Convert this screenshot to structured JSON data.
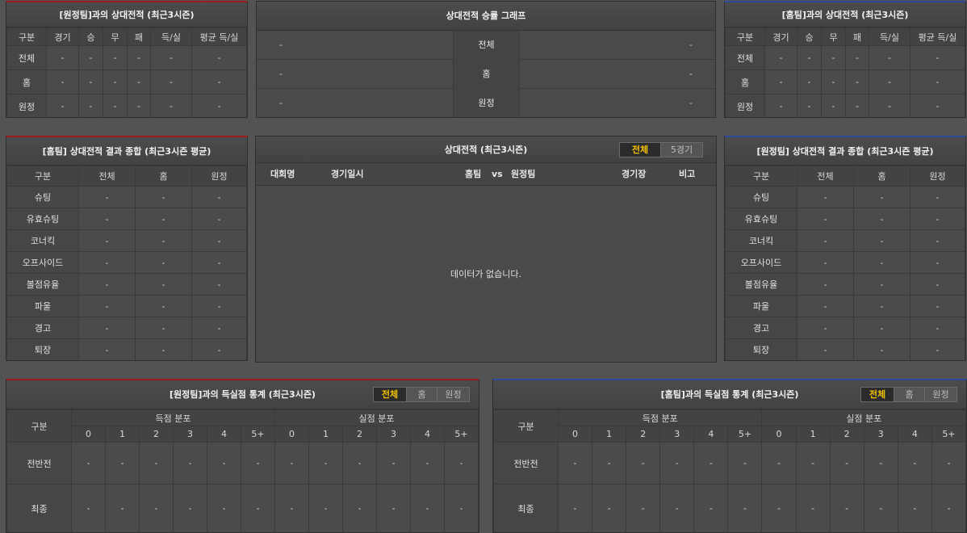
{
  "away_h2h": {
    "title": "[원정팀]과의 상대전적 (최근3시즌)",
    "headers": [
      "구분",
      "경기",
      "승",
      "무",
      "패",
      "득/실",
      "평균 득/실"
    ],
    "rows": [
      {
        "label": "전체",
        "cells": [
          "-",
          "-",
          "-",
          "-",
          "-",
          "-"
        ]
      },
      {
        "label": "홈",
        "cells": [
          "-",
          "-",
          "-",
          "-",
          "-",
          "-"
        ]
      },
      {
        "label": "원정",
        "cells": [
          "-",
          "-",
          "-",
          "-",
          "-",
          "-"
        ]
      }
    ]
  },
  "home_h2h": {
    "title": "[홈팀]과의 상대전적 (최근3시즌)",
    "headers": [
      "구분",
      "경기",
      "승",
      "무",
      "패",
      "득/실",
      "평균 득/실"
    ],
    "rows": [
      {
        "label": "전체",
        "cells": [
          "-",
          "-",
          "-",
          "-",
          "-",
          "-"
        ]
      },
      {
        "label": "홈",
        "cells": [
          "-",
          "-",
          "-",
          "-",
          "-",
          "-"
        ]
      },
      {
        "label": "원정",
        "cells": [
          "-",
          "-",
          "-",
          "-",
          "-",
          "-"
        ]
      }
    ]
  },
  "graph": {
    "title": "상대전적 승률 그래프",
    "rows": [
      {
        "label": "전체",
        "left": "-",
        "right": "-"
      },
      {
        "label": "홈",
        "left": "-",
        "right": "-"
      },
      {
        "label": "원정",
        "left": "-",
        "right": "-"
      }
    ]
  },
  "home_summary": {
    "title": "[홈팀] 상대전적 결과 종합 (최근3시즌 평균)",
    "headers": [
      "구분",
      "전체",
      "홈",
      "원정"
    ],
    "rows": [
      {
        "label": "슈팅",
        "cells": [
          "-",
          "-",
          "-"
        ]
      },
      {
        "label": "유효슈팅",
        "cells": [
          "-",
          "-",
          "-"
        ]
      },
      {
        "label": "코너킥",
        "cells": [
          "-",
          "-",
          "-"
        ]
      },
      {
        "label": "오프사이드",
        "cells": [
          "-",
          "-",
          "-"
        ]
      },
      {
        "label": "볼점유율",
        "cells": [
          "-",
          "-",
          "-"
        ]
      },
      {
        "label": "파울",
        "cells": [
          "-",
          "-",
          "-"
        ]
      },
      {
        "label": "경고",
        "cells": [
          "-",
          "-",
          "-"
        ]
      },
      {
        "label": "퇴장",
        "cells": [
          "-",
          "-",
          "-"
        ]
      }
    ]
  },
  "away_summary": {
    "title": "[원정팀] 상대전적 결과 종합 (최근3시즌 평균)",
    "headers": [
      "구분",
      "전체",
      "홈",
      "원정"
    ],
    "rows": [
      {
        "label": "슈팅",
        "cells": [
          "-",
          "-",
          "-"
        ]
      },
      {
        "label": "유효슈팅",
        "cells": [
          "-",
          "-",
          "-"
        ]
      },
      {
        "label": "코너킥",
        "cells": [
          "-",
          "-",
          "-"
        ]
      },
      {
        "label": "오프사이드",
        "cells": [
          "-",
          "-",
          "-"
        ]
      },
      {
        "label": "볼점유율",
        "cells": [
          "-",
          "-",
          "-"
        ]
      },
      {
        "label": "파울",
        "cells": [
          "-",
          "-",
          "-"
        ]
      },
      {
        "label": "경고",
        "cells": [
          "-",
          "-",
          "-"
        ]
      },
      {
        "label": "퇴장",
        "cells": [
          "-",
          "-",
          "-"
        ]
      }
    ]
  },
  "h2h_list": {
    "title": "상대전적 (최근3시즌)",
    "tabs": [
      "전체",
      "5경기"
    ],
    "columns": {
      "league": "대회명",
      "date": "경기일시",
      "home": "홈팀",
      "vs": "vs",
      "away": "원정팀",
      "venue": "경기장",
      "note": "비고"
    },
    "empty_message": "데이터가 없습니다."
  },
  "away_goals": {
    "title": "[원정팀]과의 득실점 통계 (최근3시즌)",
    "tabs": [
      "전체",
      "홈",
      "원정"
    ],
    "group_label": "구분",
    "scored_label": "득점 분포",
    "conceded_label": "실점 분포",
    "buckets": [
      "0",
      "1",
      "2",
      "3",
      "4",
      "5+"
    ],
    "rows": [
      {
        "label": "전반전",
        "cells": [
          "-",
          "-",
          "-",
          "-",
          "-",
          "-",
          "-",
          "-",
          "-",
          "-",
          "-",
          "-"
        ]
      },
      {
        "label": "최종",
        "cells": [
          "-",
          "-",
          "-",
          "-",
          "-",
          "-",
          "-",
          "-",
          "-",
          "-",
          "-",
          "-"
        ]
      }
    ]
  },
  "home_goals": {
    "title": "[홈팀]과의 득실점 통계 (최근3시즌)",
    "tabs": [
      "전체",
      "홈",
      "원정"
    ],
    "group_label": "구분",
    "scored_label": "득점 분포",
    "conceded_label": "실점 분포",
    "buckets": [
      "0",
      "1",
      "2",
      "3",
      "4",
      "5+"
    ],
    "rows": [
      {
        "label": "전반전",
        "cells": [
          "-",
          "-",
          "-",
          "-",
          "-",
          "-",
          "-",
          "-",
          "-",
          "-",
          "-",
          "-"
        ]
      },
      {
        "label": "최종",
        "cells": [
          "-",
          "-",
          "-",
          "-",
          "-",
          "-",
          "-",
          "-",
          "-",
          "-",
          "-",
          "-"
        ]
      }
    ]
  },
  "colors": {
    "background": "#535353",
    "panel": "#4a4a4a",
    "active_tab_text": "#f2c200",
    "away_accent": "#9a1c1c",
    "home_accent": "#2d4a9a"
  }
}
